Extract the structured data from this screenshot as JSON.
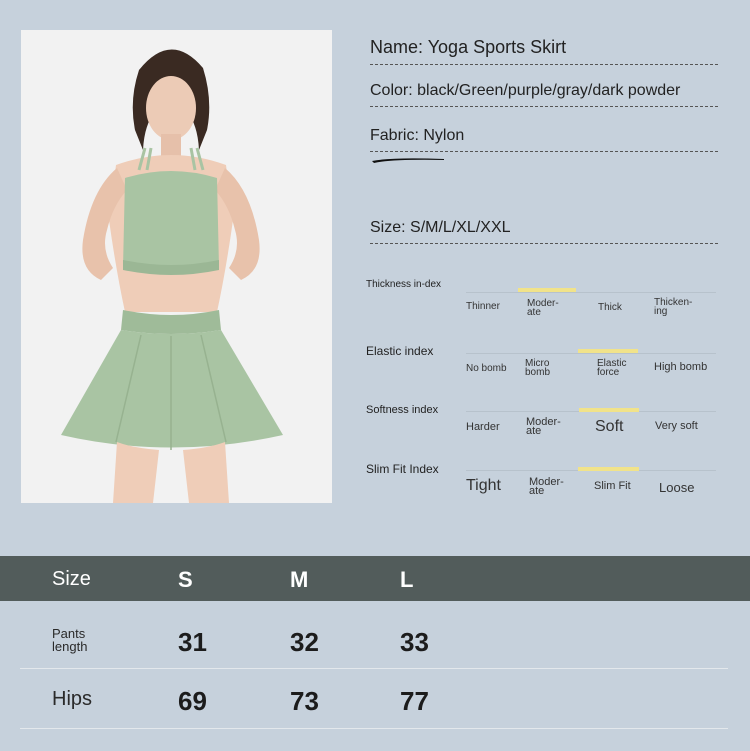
{
  "specs": {
    "name": "Name: Yoga Sports Skirt",
    "color": "Color: black/Green/purple/gray/dark powder",
    "fabric": "Fabric: Nylon",
    "size": "Size: S/M/L/XL/XXL"
  },
  "indexes": [
    {
      "label": "Thickness in-dex",
      "options": [
        "Thinner",
        "Moder-ate",
        "Thick",
        "Thicken-ing"
      ],
      "selected_index": 1
    },
    {
      "label": "Elastic index",
      "options": [
        "No bomb",
        "Micro bomb",
        "Elastic force",
        "High bomb"
      ],
      "selected_index": 2
    },
    {
      "label": "Softness index",
      "options": [
        "Harder",
        "Moder-ate",
        "Soft",
        "Very soft"
      ],
      "selected_index": 2
    },
    {
      "label": "Slim Fit Index",
      "options": [
        "Tight",
        "Moder-ate",
        "Slim Fit",
        "Loose"
      ],
      "selected_index": 2
    }
  ],
  "size_table": {
    "header_label": "Size",
    "columns": [
      "S",
      "M",
      "L"
    ],
    "rows": [
      {
        "label": "Pants length",
        "values": [
          "31",
          "32",
          "33"
        ]
      },
      {
        "label": "Hips",
        "values": [
          "69",
          "73",
          "77"
        ]
      }
    ]
  },
  "colors": {
    "background": "#c6d1dc",
    "table_header": "#525c5b",
    "highlight_bar": "#f1e38a",
    "garment_green": "#a9c4a3"
  }
}
